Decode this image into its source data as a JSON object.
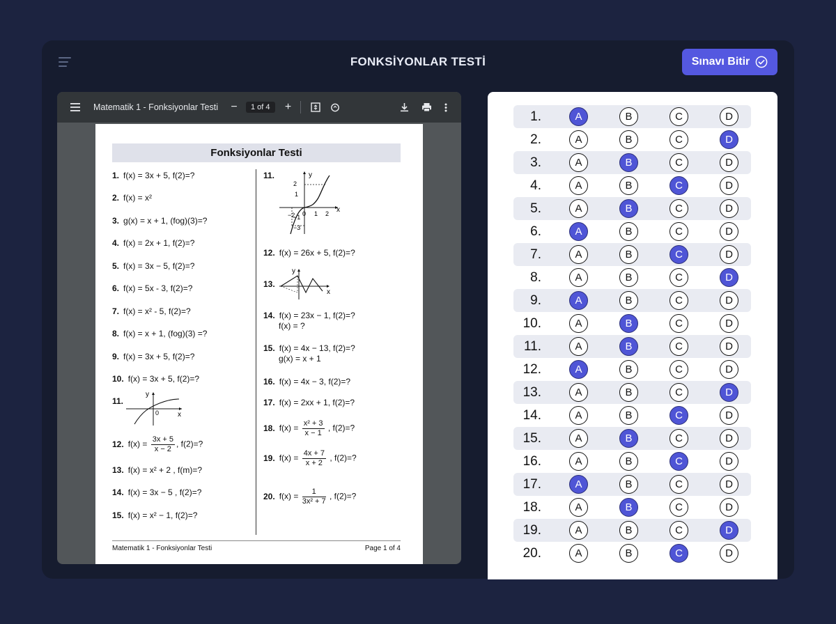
{
  "app": {
    "title": "FONKSİYONLAR TESTİ",
    "finish_label": "Sınavı Bitir",
    "accent": "#5458e0"
  },
  "viewer": {
    "doc_title": "Matematik 1 - Fonksiyonlar Testi",
    "page_indicator": "1 of 4"
  },
  "doc": {
    "heading": "Fonksiyonlar Testi",
    "left": [
      {
        "n": "1.",
        "t": "f(x) = 3x + 5,   f(2)=?"
      },
      {
        "n": "2.",
        "t": "f(x) = x²"
      },
      {
        "n": "3.",
        "t": "g(x) = x + 1,  (fog)(3)=?"
      },
      {
        "n": "4.",
        "t": "f(x) = 2x + 1,   f(2)=?"
      },
      {
        "n": "5.",
        "t": "f(x) = 3x − 5,   f(2)=?"
      },
      {
        "n": "6.",
        "t": "f(x) = 5x - 3,   f(2)=?"
      },
      {
        "n": "7.",
        "t": "f(x) = x² - 5,   f(2)=?"
      },
      {
        "n": "8.",
        "t": "f(x) = x + 1,   (fog)(3) =?"
      },
      {
        "n": "9.",
        "t": "f(x) = 3x + 5,   f(2)=?"
      },
      {
        "n": "10.",
        "t": "f(x) = 3x + 5,   f(2)=?"
      },
      {
        "n": "11.",
        "t": ""
      },
      {
        "n": "12.",
        "t": "f(x) = ",
        "frac_num": "3x + 5",
        "frac_den": "x − 2",
        "after": ",    f(2)=?"
      },
      {
        "n": "13.",
        "t": "f(x) = x² + 2 ,    f(m)=?"
      },
      {
        "n": "14.",
        "t": "f(x) = 3x − 5 ,    f(2)=?"
      },
      {
        "n": "15.",
        "t": "f(x) = x² − 1,    f(2)=?"
      }
    ],
    "right": [
      {
        "n": "11.",
        "t": ""
      },
      {
        "n": "12.",
        "t": "f(x) = 26x + 5,    f(2)=?"
      },
      {
        "n": "13.",
        "t": ""
      },
      {
        "n": "14.",
        "t": "f(x) = 23x − 1,    f(2)=?",
        "t2": "f(x) = ?"
      },
      {
        "n": "15.",
        "t": "f(x) = 4x − 13,    f(2)=?",
        "t2": "g(x) = x + 1"
      },
      {
        "n": "16.",
        "t": "f(x) = 4x − 3,    f(2)=?"
      },
      {
        "n": "17.",
        "t": "f(x) = 2xx + 1,    f(2)=?"
      },
      {
        "n": "18.",
        "t": "f(x) = ",
        "frac_num": "x² + 3",
        "frac_den": "x − 1",
        "after": " ,    f(2)=?"
      },
      {
        "n": "19.",
        "t": "f(x) = ",
        "frac_num": "4x + 7",
        "frac_den": "x + 2",
        "after": " ,    f(2)=?"
      },
      {
        "n": "20.",
        "t": "f(x) = ",
        "frac_num": "1",
        "frac_den": "3x² + 7",
        "after": " ,    f(2)=?"
      }
    ],
    "graph_labels": {
      "y": "y",
      "x": "x",
      "zero": "0",
      "g11r": [
        "2",
        "1",
        "−2",
        "0",
        "1",
        "2",
        "−1",
        "−3"
      ]
    },
    "footer_left": "Matematik 1 - Fonksiyonlar Testi",
    "footer_right": "Page 1 of 4"
  },
  "answer_sheet": {
    "option_labels": [
      "A",
      "B",
      "C",
      "D"
    ],
    "rows": [
      {
        "num": "1.",
        "selected": "A"
      },
      {
        "num": "2.",
        "selected": "D"
      },
      {
        "num": "3.",
        "selected": "B"
      },
      {
        "num": "4.",
        "selected": "C"
      },
      {
        "num": "5.",
        "selected": "B"
      },
      {
        "num": "6.",
        "selected": "A"
      },
      {
        "num": "7.",
        "selected": "C"
      },
      {
        "num": "8.",
        "selected": "D"
      },
      {
        "num": "9.",
        "selected": "A"
      },
      {
        "num": "10.",
        "selected": "B"
      },
      {
        "num": "11.",
        "selected": "B"
      },
      {
        "num": "12.",
        "selected": "A"
      },
      {
        "num": "13.",
        "selected": "D"
      },
      {
        "num": "14.",
        "selected": "C"
      },
      {
        "num": "15.",
        "selected": "B"
      },
      {
        "num": "16.",
        "selected": "C"
      },
      {
        "num": "17.",
        "selected": "A"
      },
      {
        "num": "18.",
        "selected": "B"
      },
      {
        "num": "19.",
        "selected": "D"
      },
      {
        "num": "20.",
        "selected": "C"
      }
    ]
  }
}
